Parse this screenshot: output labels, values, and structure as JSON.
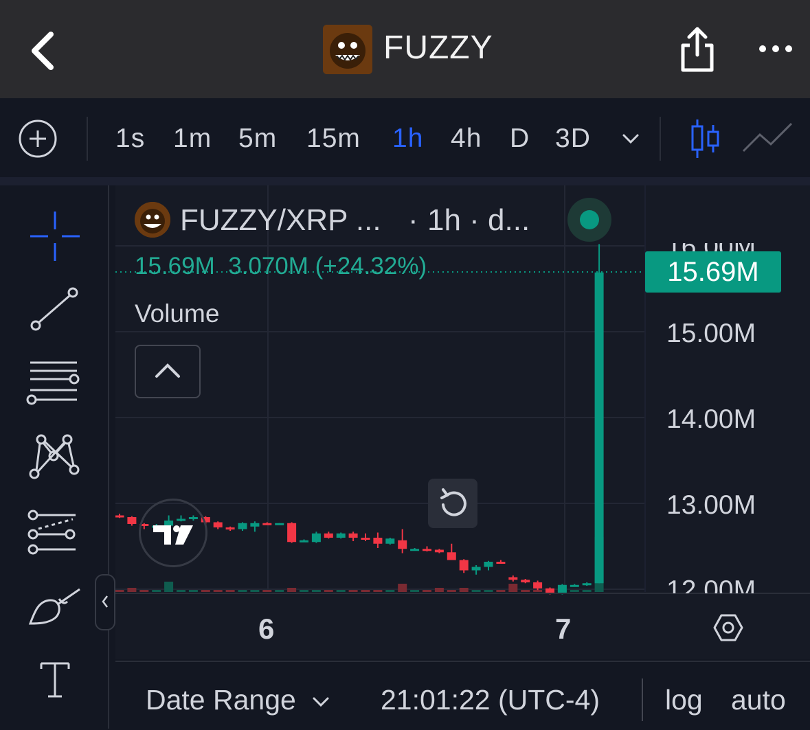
{
  "header": {
    "title": "FUZZY",
    "icons": {
      "back": "chevron-left-icon",
      "share": "share-icon",
      "more": "more-horizontal-icon"
    }
  },
  "toolbar": {
    "timeframes": [
      "1s",
      "1m",
      "5m",
      "15m",
      "1h",
      "4h",
      "D",
      "3D"
    ],
    "active_timeframe": "1h",
    "accent_color": "#2962ff"
  },
  "legend": {
    "symbol": "FUZZY/XRP ...",
    "separator": "·",
    "interval": "1h · d...",
    "values": "15.69M  3.070M (+24.32%)",
    "volume_label": "Volume",
    "status_color": "#089981"
  },
  "price_axis": {
    "labels": [
      "16.00M",
      "15.00M",
      "14.00M",
      "13.00M",
      "12.00M"
    ],
    "last_price": "15.69M"
  },
  "time_axis": {
    "labels": [
      "6",
      "7"
    ]
  },
  "bottom": {
    "date_range": "Date Range",
    "clock": "21:01:22 (UTC-4)",
    "log": "log",
    "auto": "auto"
  },
  "colors": {
    "up": "#089981",
    "down": "#f23645"
  },
  "chart_data": {
    "type": "candlestick",
    "x_labels": [
      "6",
      "7"
    ],
    "ylim": [
      11900000,
      16100000
    ],
    "candles": [
      {
        "o": 12.86,
        "h": 12.88,
        "l": 12.83,
        "c": 12.84
      },
      {
        "o": 12.84,
        "h": 12.85,
        "l": 12.74,
        "c": 12.76
      },
      {
        "o": 12.76,
        "h": 12.77,
        "l": 12.7,
        "c": 12.74
      },
      {
        "o": 12.74,
        "h": 12.76,
        "l": 12.71,
        "c": 12.74
      },
      {
        "o": 12.74,
        "h": 12.86,
        "l": 12.73,
        "c": 12.8
      },
      {
        "o": 12.8,
        "h": 12.86,
        "l": 12.79,
        "c": 12.82
      },
      {
        "o": 12.82,
        "h": 12.86,
        "l": 12.8,
        "c": 12.84
      },
      {
        "o": 12.84,
        "h": 12.85,
        "l": 12.73,
        "c": 12.78
      },
      {
        "o": 12.78,
        "h": 12.79,
        "l": 12.7,
        "c": 12.72
      },
      {
        "o": 12.72,
        "h": 12.73,
        "l": 12.68,
        "c": 12.7
      },
      {
        "o": 12.7,
        "h": 12.78,
        "l": 12.68,
        "c": 12.77
      },
      {
        "o": 12.73,
        "h": 12.79,
        "l": 12.67,
        "c": 12.77
      },
      {
        "o": 12.77,
        "h": 12.78,
        "l": 12.75,
        "c": 12.76
      },
      {
        "o": 12.76,
        "h": 12.77,
        "l": 12.75,
        "c": 12.77
      },
      {
        "o": 12.77,
        "h": 12.78,
        "l": 12.54,
        "c": 12.55
      },
      {
        "o": 12.57,
        "h": 12.58,
        "l": 12.55,
        "c": 12.57
      },
      {
        "o": 12.55,
        "h": 12.67,
        "l": 12.54,
        "c": 12.65
      },
      {
        "o": 12.65,
        "h": 12.67,
        "l": 12.59,
        "c": 12.6
      },
      {
        "o": 12.6,
        "h": 12.66,
        "l": 12.59,
        "c": 12.65
      },
      {
        "o": 12.65,
        "h": 12.67,
        "l": 12.56,
        "c": 12.6
      },
      {
        "o": 12.6,
        "h": 12.65,
        "l": 12.56,
        "c": 12.58
      },
      {
        "o": 12.6,
        "h": 12.66,
        "l": 12.48,
        "c": 12.53
      },
      {
        "o": 12.53,
        "h": 12.6,
        "l": 12.52,
        "c": 12.59
      },
      {
        "o": 12.57,
        "h": 12.7,
        "l": 12.42,
        "c": 12.47
      },
      {
        "o": 12.47,
        "h": 12.48,
        "l": 12.46,
        "c": 12.47
      },
      {
        "o": 12.47,
        "h": 12.5,
        "l": 12.44,
        "c": 12.46
      },
      {
        "o": 12.46,
        "h": 12.47,
        "l": 12.42,
        "c": 12.43
      },
      {
        "o": 12.43,
        "h": 12.53,
        "l": 12.4,
        "c": 12.34
      },
      {
        "o": 12.34,
        "h": 12.35,
        "l": 12.19,
        "c": 12.22
      },
      {
        "o": 12.22,
        "h": 12.28,
        "l": 12.17,
        "c": 12.26
      },
      {
        "o": 12.26,
        "h": 12.33,
        "l": 12.22,
        "c": 12.32
      },
      {
        "o": 12.32,
        "h": 12.34,
        "l": 12.3,
        "c": 12.31
      },
      {
        "o": 12.14,
        "h": 12.16,
        "l": 12.09,
        "c": 12.11
      },
      {
        "o": 12.11,
        "h": 12.12,
        "l": 12.07,
        "c": 12.08
      },
      {
        "o": 12.08,
        "h": 12.1,
        "l": 11.99,
        "c": 12.01
      },
      {
        "o": 12.01,
        "h": 12.02,
        "l": 11.94,
        "c": 11.95
      },
      {
        "o": 11.95,
        "h": 12.06,
        "l": 11.94,
        "c": 12.05
      },
      {
        "o": 12.05,
        "h": 12.06,
        "l": 12.03,
        "c": 12.05
      },
      {
        "o": 12.05,
        "h": 12.08,
        "l": 12.04,
        "c": 12.07
      },
      {
        "o": 12.07,
        "h": 16.02,
        "l": 12.07,
        "c": 15.69
      }
    ],
    "volume": [
      1,
      2,
      1,
      1,
      5,
      1,
      1,
      1,
      1,
      1,
      1,
      1,
      1,
      1,
      2,
      1,
      1,
      1,
      1,
      1,
      1,
      1,
      1,
      4,
      1,
      1,
      2,
      1,
      2,
      1,
      1,
      1,
      4,
      1,
      1,
      1,
      1,
      1,
      1,
      28
    ],
    "last_price": 15690000,
    "change": "3.070M",
    "change_pct": "+24.32%"
  }
}
